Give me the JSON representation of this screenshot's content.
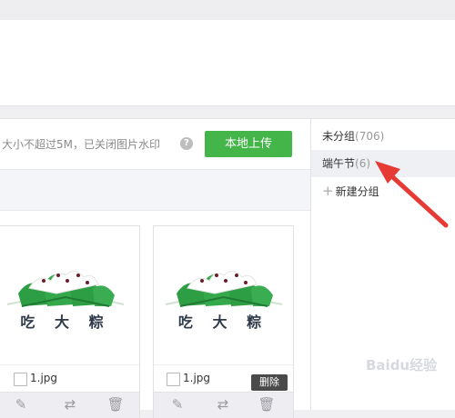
{
  "upload_bar": {
    "hint": "大小不超过5M，已关闭图片水印",
    "help_icon": "?",
    "upload_label": "本地上传"
  },
  "sidebar": {
    "groups": [
      {
        "name": "未分组",
        "count": "(706)"
      },
      {
        "name": "端午节",
        "count": "(6)"
      }
    ],
    "new_group": "新建分组"
  },
  "images": [
    {
      "caption": "吃 大 粽",
      "filename": "1.jpg"
    },
    {
      "caption": "吃 大 粽",
      "filename": "1.jpg"
    }
  ],
  "tooltip": "删除",
  "watermark": "Baidu经验",
  "colors": {
    "primary_green": "#44b549",
    "annotation_red": "#e63b35"
  }
}
